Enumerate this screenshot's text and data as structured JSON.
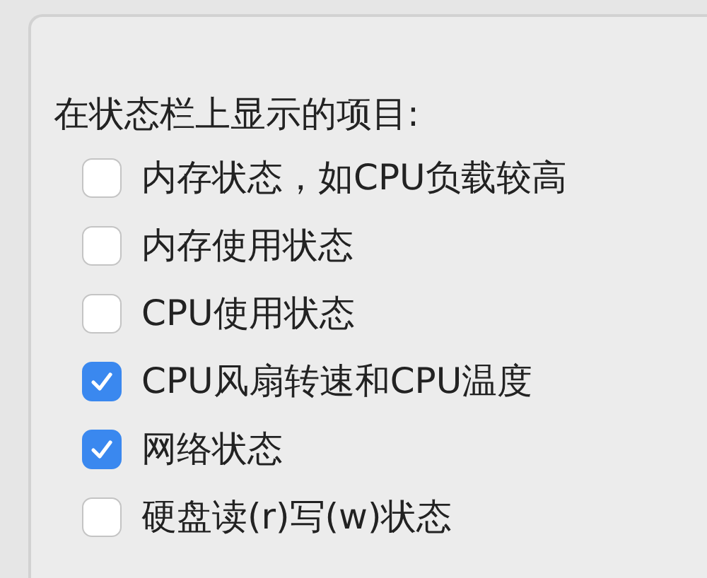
{
  "section": {
    "title": "在状态栏上显示的项目:"
  },
  "items": [
    {
      "label": "内存状态，如CPU负载较高",
      "checked": false
    },
    {
      "label": "内存使用状态",
      "checked": false
    },
    {
      "label": "CPU使用状态",
      "checked": false
    },
    {
      "label": "CPU风扇转速和CPU温度",
      "checked": true
    },
    {
      "label": "网络状态",
      "checked": true
    },
    {
      "label": "硬盘读(r)写(w)状态",
      "checked": false
    }
  ]
}
